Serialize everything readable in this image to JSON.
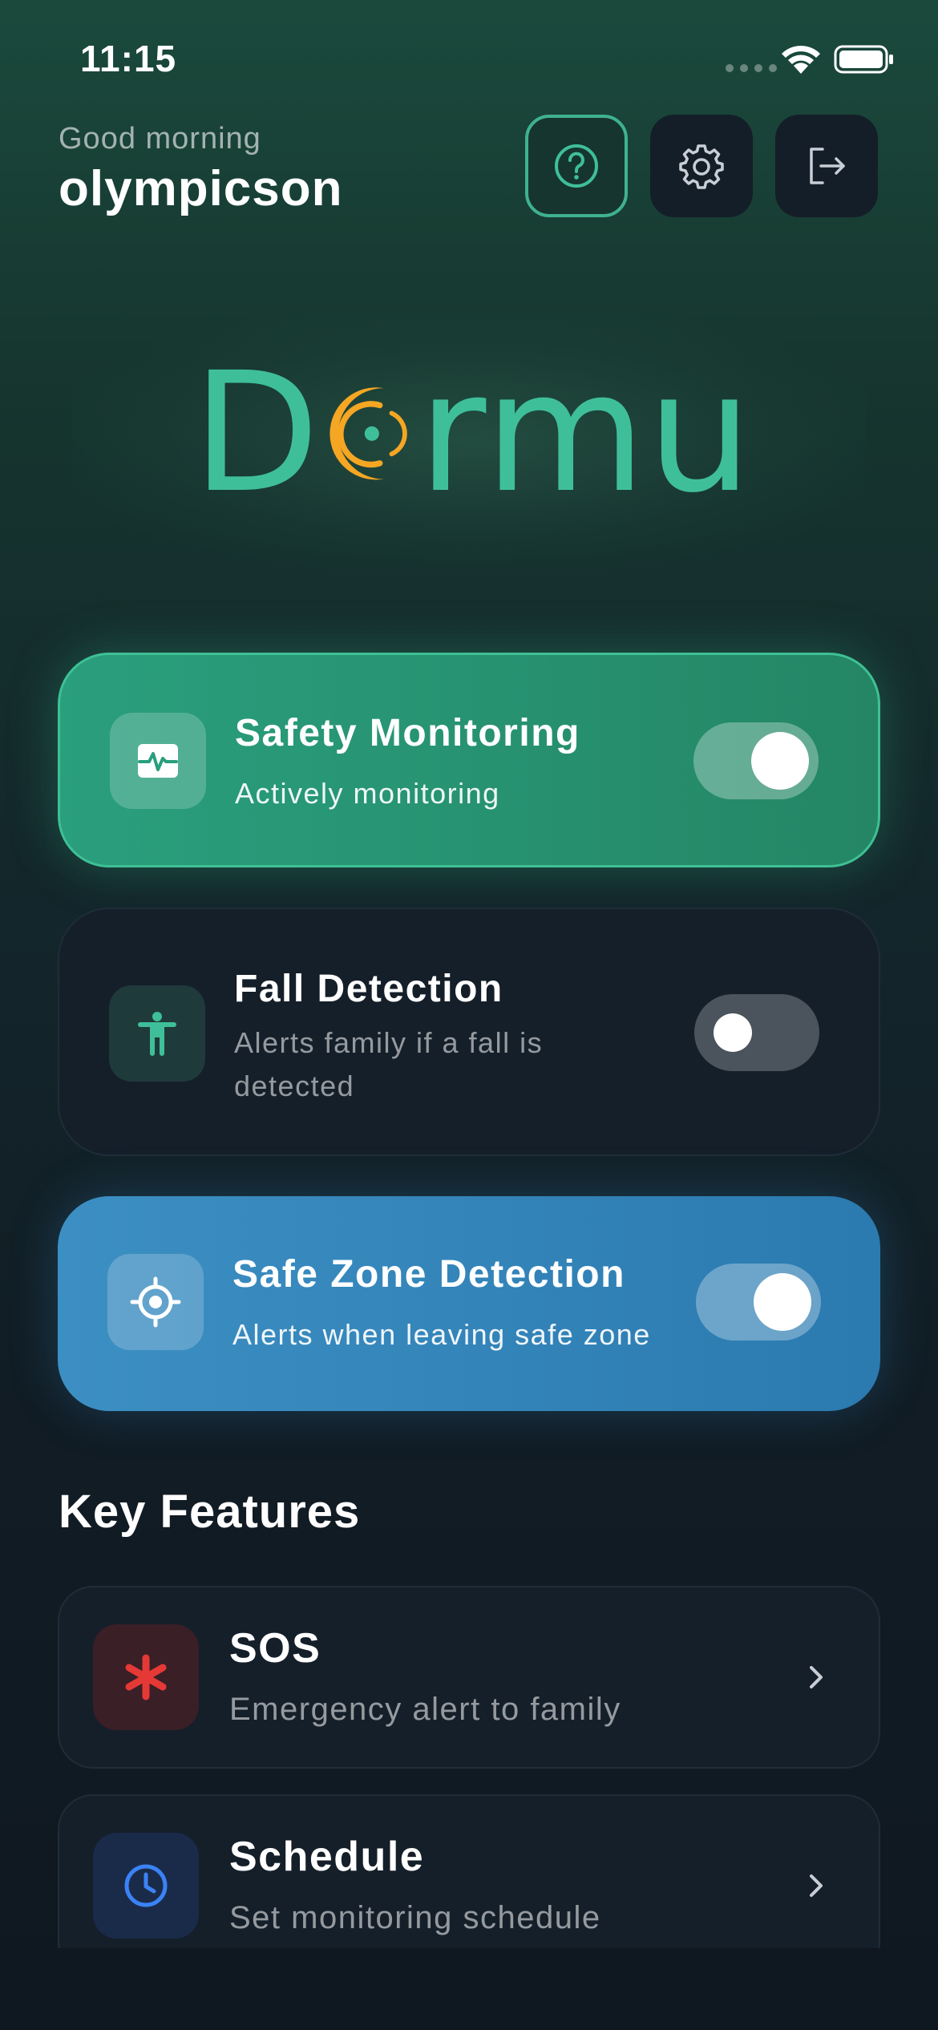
{
  "status_bar": {
    "time": "11:15"
  },
  "header": {
    "greeting": "Good morning",
    "username": "olympicson",
    "buttons": [
      {
        "name": "help",
        "icon": "question-circle-icon"
      },
      {
        "name": "settings",
        "icon": "gear-icon"
      },
      {
        "name": "logout",
        "icon": "logout-icon"
      }
    ]
  },
  "logo": {
    "letter_1": "D",
    "letters_rest": "rmu",
    "brand_color": "#3fbf99",
    "accent_color": "#f5a623"
  },
  "toggles": [
    {
      "title": "Safety Monitoring",
      "subtitle": "Actively monitoring",
      "enabled": true,
      "icon": "heart-pulse-icon",
      "color": "#2a9f7d"
    },
    {
      "title": "Fall Detection",
      "subtitle": "Alerts family if a fall is detected",
      "enabled": false,
      "icon": "person-icon",
      "color": "#151f2a"
    },
    {
      "title": "Safe Zone Detection",
      "subtitle": "Alerts when leaving safe zone",
      "enabled": true,
      "icon": "crosshair-icon",
      "color": "#3c8fc3"
    }
  ],
  "key_features": {
    "title": "Key Features",
    "items": [
      {
        "title": "SOS",
        "subtitle": "Emergency alert to family",
        "icon": "asterisk-icon",
        "color": "#e53935"
      },
      {
        "title": "Schedule",
        "subtitle": "Set monitoring schedule",
        "icon": "clock-icon",
        "color": "#3b82f6"
      }
    ]
  }
}
